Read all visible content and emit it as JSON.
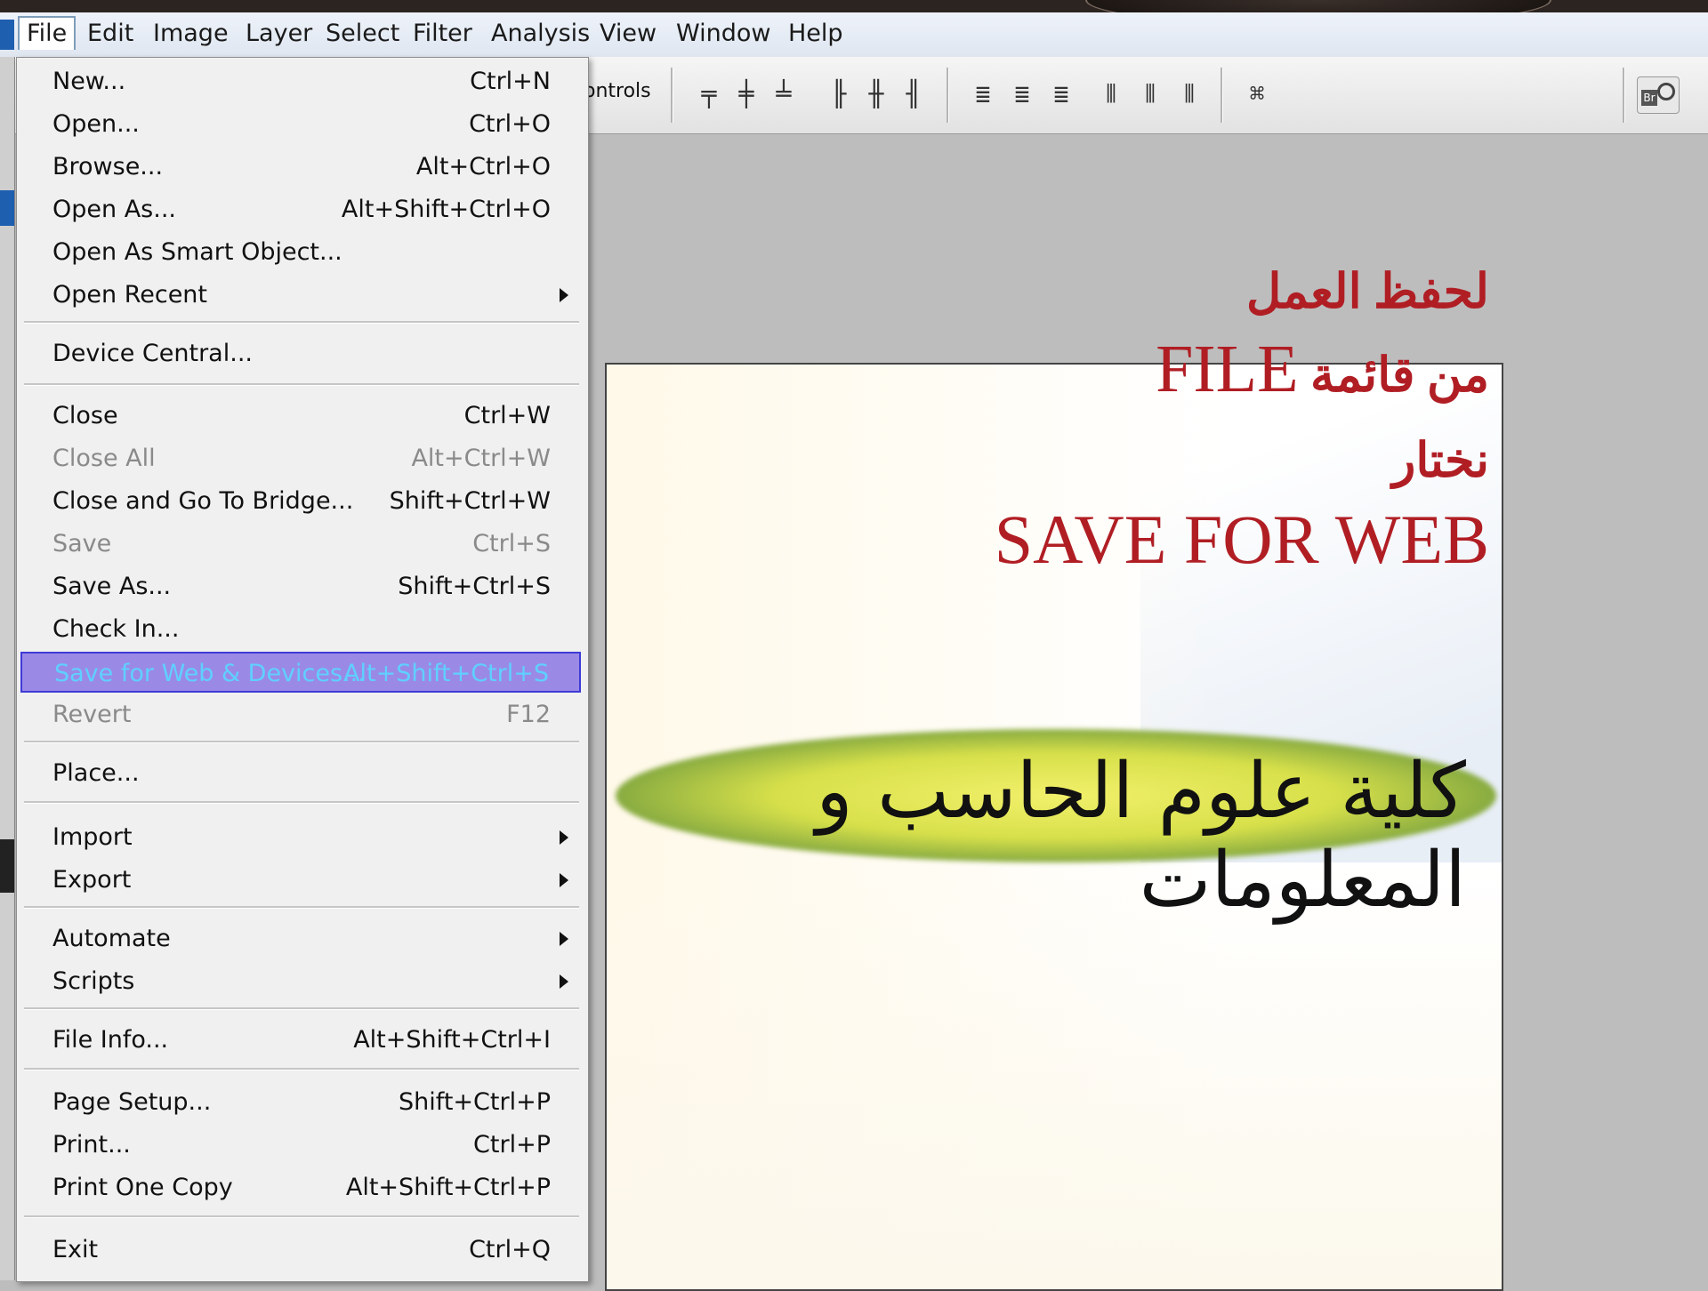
{
  "menubar": {
    "items": [
      "File",
      "Edit",
      "Image",
      "Layer",
      "Select",
      "Filter",
      "Analysis",
      "View",
      "Window",
      "Help"
    ]
  },
  "options_bar": {
    "label": "ontrols"
  },
  "file_menu": {
    "items": [
      {
        "label": "New...",
        "shortcut": "Ctrl+N"
      },
      {
        "label": "Open...",
        "shortcut": "Ctrl+O"
      },
      {
        "label": "Browse...",
        "shortcut": "Alt+Ctrl+O"
      },
      {
        "label": "Open As...",
        "shortcut": "Alt+Shift+Ctrl+O"
      },
      {
        "label": "Open As Smart Object...",
        "shortcut": ""
      },
      {
        "label": "Open Recent",
        "shortcut": ""
      },
      {
        "label": "Device Central...",
        "shortcut": ""
      },
      {
        "label": "Close",
        "shortcut": "Ctrl+W"
      },
      {
        "label": "Close All",
        "shortcut": "Alt+Ctrl+W"
      },
      {
        "label": "Close and Go To Bridge...",
        "shortcut": "Shift+Ctrl+W"
      },
      {
        "label": "Save",
        "shortcut": "Ctrl+S"
      },
      {
        "label": "Save As...",
        "shortcut": "Shift+Ctrl+S"
      },
      {
        "label": "Check In...",
        "shortcut": ""
      },
      {
        "label": "Save for Web & Devices...",
        "shortcut": "Alt+Shift+Ctrl+S"
      },
      {
        "label": "Revert",
        "shortcut": "F12"
      },
      {
        "label": "Place...",
        "shortcut": ""
      },
      {
        "label": "Import",
        "shortcut": ""
      },
      {
        "label": "Export",
        "shortcut": ""
      },
      {
        "label": "Automate",
        "shortcut": ""
      },
      {
        "label": "Scripts",
        "shortcut": ""
      },
      {
        "label": "File Info...",
        "shortcut": "Alt+Shift+Ctrl+I"
      },
      {
        "label": "Page Setup...",
        "shortcut": "Shift+Ctrl+P"
      },
      {
        "label": "Print...",
        "shortcut": "Ctrl+P"
      },
      {
        "label": "Print One Copy",
        "shortcut": "Alt+Shift+Ctrl+P"
      },
      {
        "label": "Exit",
        "shortcut": "Ctrl+Q"
      }
    ]
  },
  "document": {
    "banner_text": "كلية علوم الحاسب و المعلومات"
  },
  "instructions": {
    "line1": "لحفظ العمل",
    "line2_ar": "من قائمة",
    "line2_file": "FILE",
    "line3": "نختار",
    "line4": "SAVE FOR WEB"
  },
  "colors": {
    "highlight_bg": "#9a8ae6",
    "highlight_text": "#5fd0ff",
    "instruction_red": "#b01e24"
  }
}
